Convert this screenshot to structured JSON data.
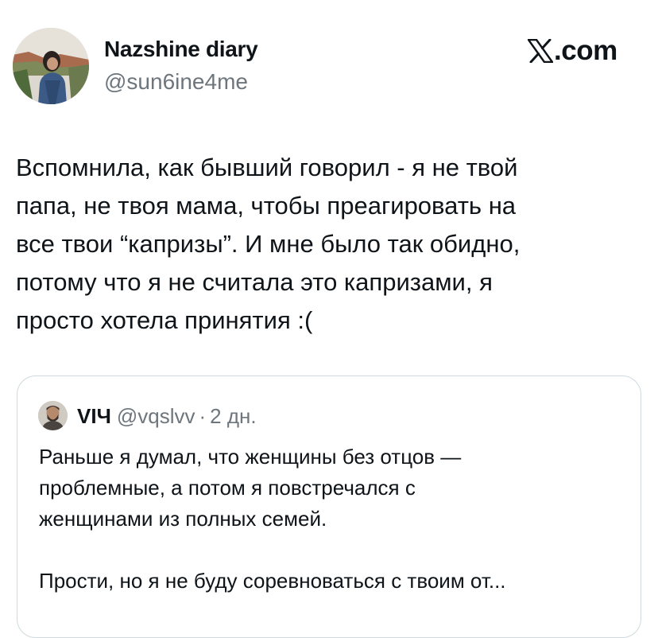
{
  "author": {
    "name": "Nazshine diary",
    "handle": "@sun6ine4me"
  },
  "brand": {
    "label": ".com",
    "icon": "x-logo-icon"
  },
  "tweet": {
    "lines": [
      "Вспомнила, как бывший говорил - я не твой",
      "папа, не твоя мама, чтобы преагировать на",
      "все твои “капризы”. И мне было так обидно,",
      "потому что я не считала это капризами, я",
      "просто хотела принятия :("
    ]
  },
  "quoted_tweet": {
    "name": "VIЧ",
    "handle": "@vqslvv",
    "separator": "·",
    "time": "2 дн.",
    "lines": [
      "Раньше я думал, что женщины без отцов —",
      "проблемные, а потом я повстречался с",
      "женщинами из полных семей.",
      "",
      "Прости, но я не буду соревноваться с твоим от..."
    ]
  },
  "colors": {
    "text": "#0f1419",
    "secondary": "#6e767d",
    "border": "#cfd9de"
  }
}
